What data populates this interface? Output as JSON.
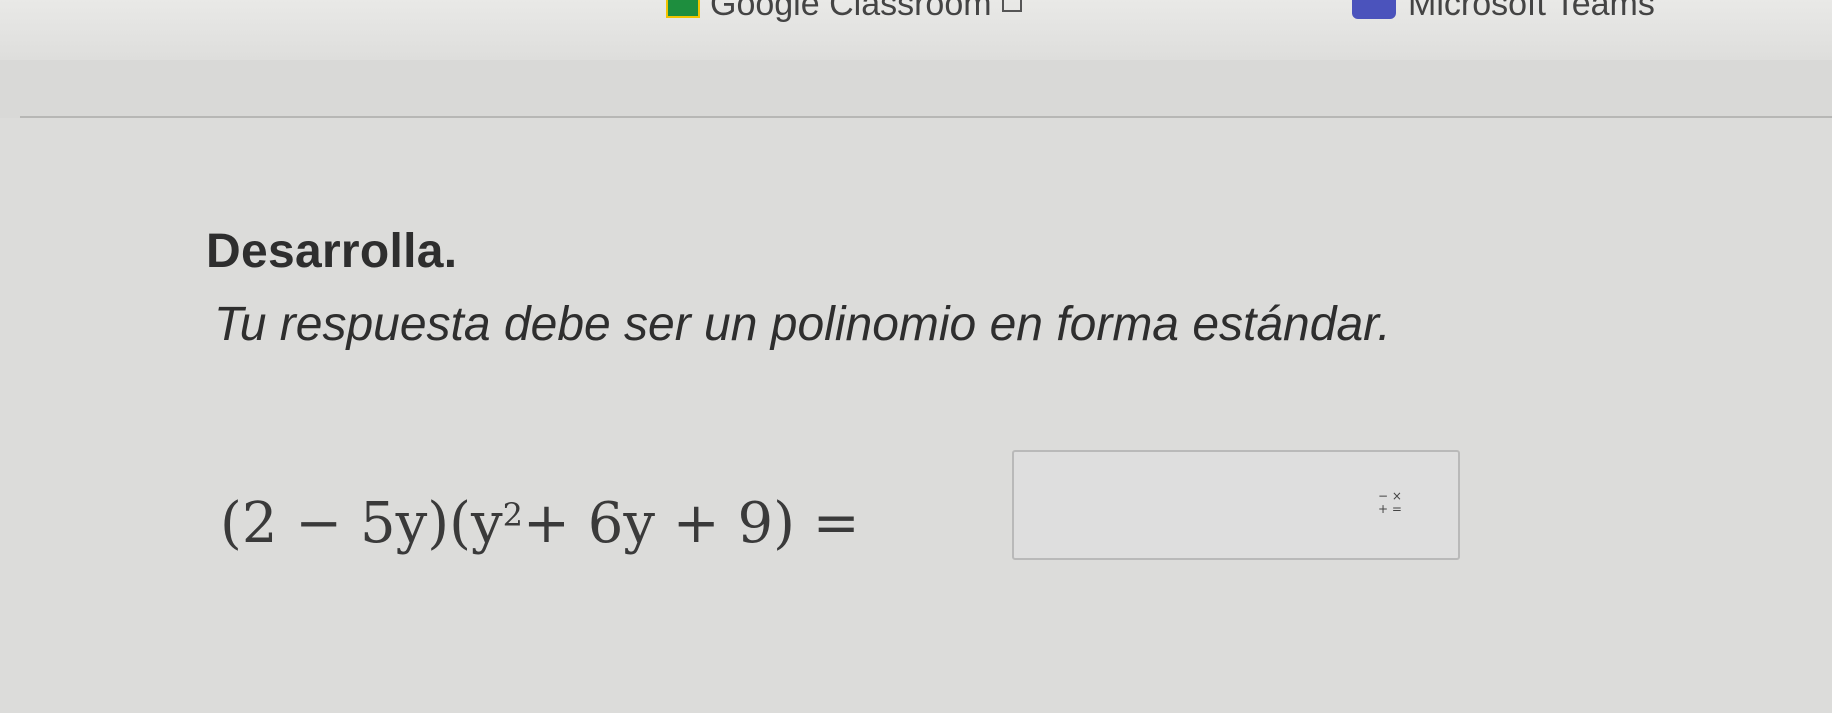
{
  "bookmarks": {
    "classroom_label": "Google Classroom",
    "teams_label": "Microsoft Teams"
  },
  "question": {
    "title": "Desarrolla.",
    "instruction": "Tu respuesta debe ser un polinomio en forma estándar.",
    "expression_main": "(2 − 5y)(y",
    "expression_exponent": "2",
    "expression_rest": " + 6y + 9) ="
  },
  "answer": {
    "value": "",
    "placeholder": ""
  },
  "icons": {
    "keypad": "math-keypad-icon",
    "keypad_top": "− ×",
    "keypad_bottom": "+ ="
  }
}
